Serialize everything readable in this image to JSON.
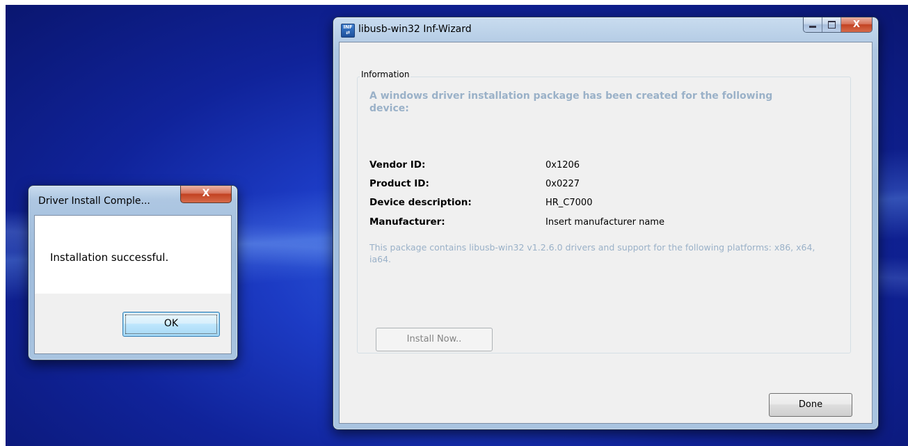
{
  "main_window": {
    "title": "libusb-win32 Inf-Wizard",
    "icon_text_top": "INF",
    "icon_text_bottom": "⇄",
    "group_title": "Information",
    "headline": "A windows driver installation package has been created for the following device:",
    "fields": [
      {
        "label": "Vendor ID:",
        "value": "0x1206"
      },
      {
        "label": "Product ID:",
        "value": "0x0227"
      },
      {
        "label": "Device description:",
        "value": "HR_C7000"
      },
      {
        "label": "Manufacturer:",
        "value": "Insert manufacturer name"
      }
    ],
    "note": "This package contains libusb-win32 v1.2.6.0 drivers and support for the following platforms: x86, x64, ia64.",
    "install_button": "Install Now..",
    "done_button": "Done",
    "close_glyph": "X"
  },
  "dialog": {
    "title": "Driver Install Comple...",
    "message": "Installation successful.",
    "ok_button": "OK",
    "close_glyph": "X"
  },
  "colors": {
    "desktop": "#1c3bc4",
    "headline": "#9ab1c8",
    "client": "#f0f0f0"
  }
}
